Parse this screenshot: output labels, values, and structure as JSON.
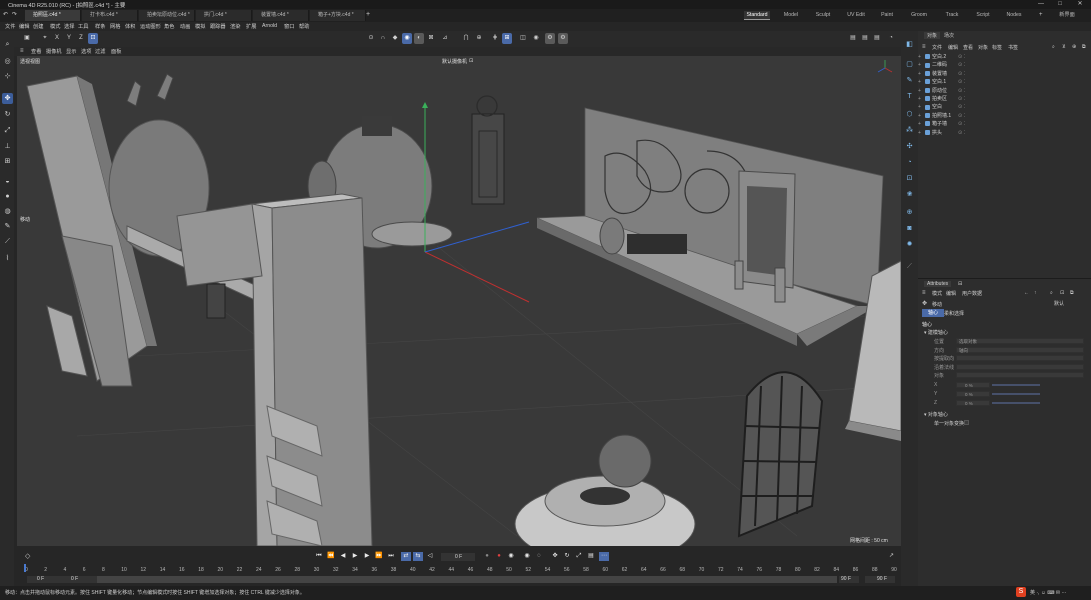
{
  "window": {
    "title": "Cinema 4D R25.010 (RC) - [拍照區.c4d *] - 主要",
    "controls": [
      "—",
      "□",
      "✕"
    ]
  },
  "doc_tabs": [
    {
      "label": "拍照區.c4d *",
      "active": true
    },
    {
      "label": "打卡布.c4d *",
      "active": false
    },
    {
      "label": "拍卖坛原动位.c4d *",
      "active": false
    },
    {
      "label": "拱门.c4d *",
      "active": false
    },
    {
      "label": "装置墙.c4d *",
      "active": false
    },
    {
      "label": "箱子+方块.c4d *",
      "active": false
    }
  ],
  "add_tab": "+",
  "layout_tabs": [
    {
      "label": "Standard",
      "active": true
    },
    {
      "label": "Model",
      "active": false
    },
    {
      "label": "Sculpt",
      "active": false
    },
    {
      "label": "UV Edit",
      "active": false
    },
    {
      "label": "Paint",
      "active": false
    },
    {
      "label": "Groom",
      "active": false
    },
    {
      "label": "Track",
      "active": false
    },
    {
      "label": "Script",
      "active": false
    },
    {
      "label": "Nodes",
      "active": false
    }
  ],
  "new_layout": "新界面",
  "menu": [
    "文件",
    "编辑",
    "创建",
    "模式",
    "选择",
    "工具",
    "样条",
    "网格",
    "体积",
    "运动图形",
    "角色",
    "动画",
    "模拟",
    "跟踪器",
    "渲染",
    "扩展",
    "Arnold",
    "窗口",
    "帮助"
  ],
  "toolbar": {
    "axes": [
      "X",
      "Y",
      "Z"
    ]
  },
  "viewport": {
    "menu": [
      "查看",
      "摄像机",
      "显示",
      "选项",
      "过滤",
      "面板"
    ],
    "view_name": "透视视图",
    "camera": "默认摄像机",
    "move_label": "移动",
    "grid_spacing": "网格间距 : 50 cm"
  },
  "object_manager": {
    "tabs": [
      "对象",
      "场次"
    ],
    "menu": [
      "文件",
      "编辑",
      "查看",
      "对象",
      "标签",
      "书签"
    ],
    "objects": [
      "空白.2",
      "二维码",
      "装置墙",
      "空白.1",
      "原动位",
      "拍卖区",
      "空白",
      "拍照墙.1",
      "箱子墙",
      "拱头"
    ]
  },
  "attributes": {
    "title": "Attributes",
    "menu": [
      "模式",
      "编辑",
      "用户数据"
    ],
    "mode": "默认",
    "tool": "移动",
    "tabs": [
      "轴心",
      "柔和选择"
    ],
    "section": "轴心",
    "group1": "建模轴心",
    "fields": [
      {
        "label": "位置",
        "value": "选取对象"
      },
      {
        "label": "方向",
        "value": "轴向"
      },
      {
        "label": "按提取向",
        "value": ""
      },
      {
        "label": "沿着法线",
        "value": ""
      },
      {
        "label": "对象",
        "value": ""
      }
    ],
    "xyz": [
      {
        "label": "X",
        "value": "0 %"
      },
      {
        "label": "Y",
        "value": "0 %"
      },
      {
        "label": "Z",
        "value": "0 %"
      }
    ],
    "group2": "对象轴心",
    "single_transform": "单一对象变换"
  },
  "timeline": {
    "ruler": [
      "0",
      "2",
      "4",
      "6",
      "8",
      "10",
      "12",
      "14",
      "16",
      "18",
      "20",
      "22",
      "24",
      "26",
      "28",
      "30",
      "32",
      "34",
      "36",
      "38",
      "40",
      "42",
      "44",
      "46",
      "48",
      "50",
      "52",
      "54",
      "56",
      "58",
      "60",
      "62",
      "64",
      "66",
      "68",
      "70",
      "72",
      "74",
      "76",
      "78",
      "80",
      "82",
      "84",
      "86",
      "88",
      "90"
    ],
    "current_frame": "0 F",
    "start_frame": "0 F",
    "min_frame": "0 F",
    "max_frame": "90 F",
    "end_frame": "90 F"
  },
  "status": {
    "text": "移动：点击并拖动鼠标移动元素。按住 SHIFT 键量化移动；节点编辑模式时按住 SHIFT 键增加选择对象；按住 CTRL 键减少选择对象。"
  },
  "colors": {
    "accent": "#4a6aa8",
    "viewport_bg": "#393939",
    "panel_bg": "#2d2d2d"
  }
}
